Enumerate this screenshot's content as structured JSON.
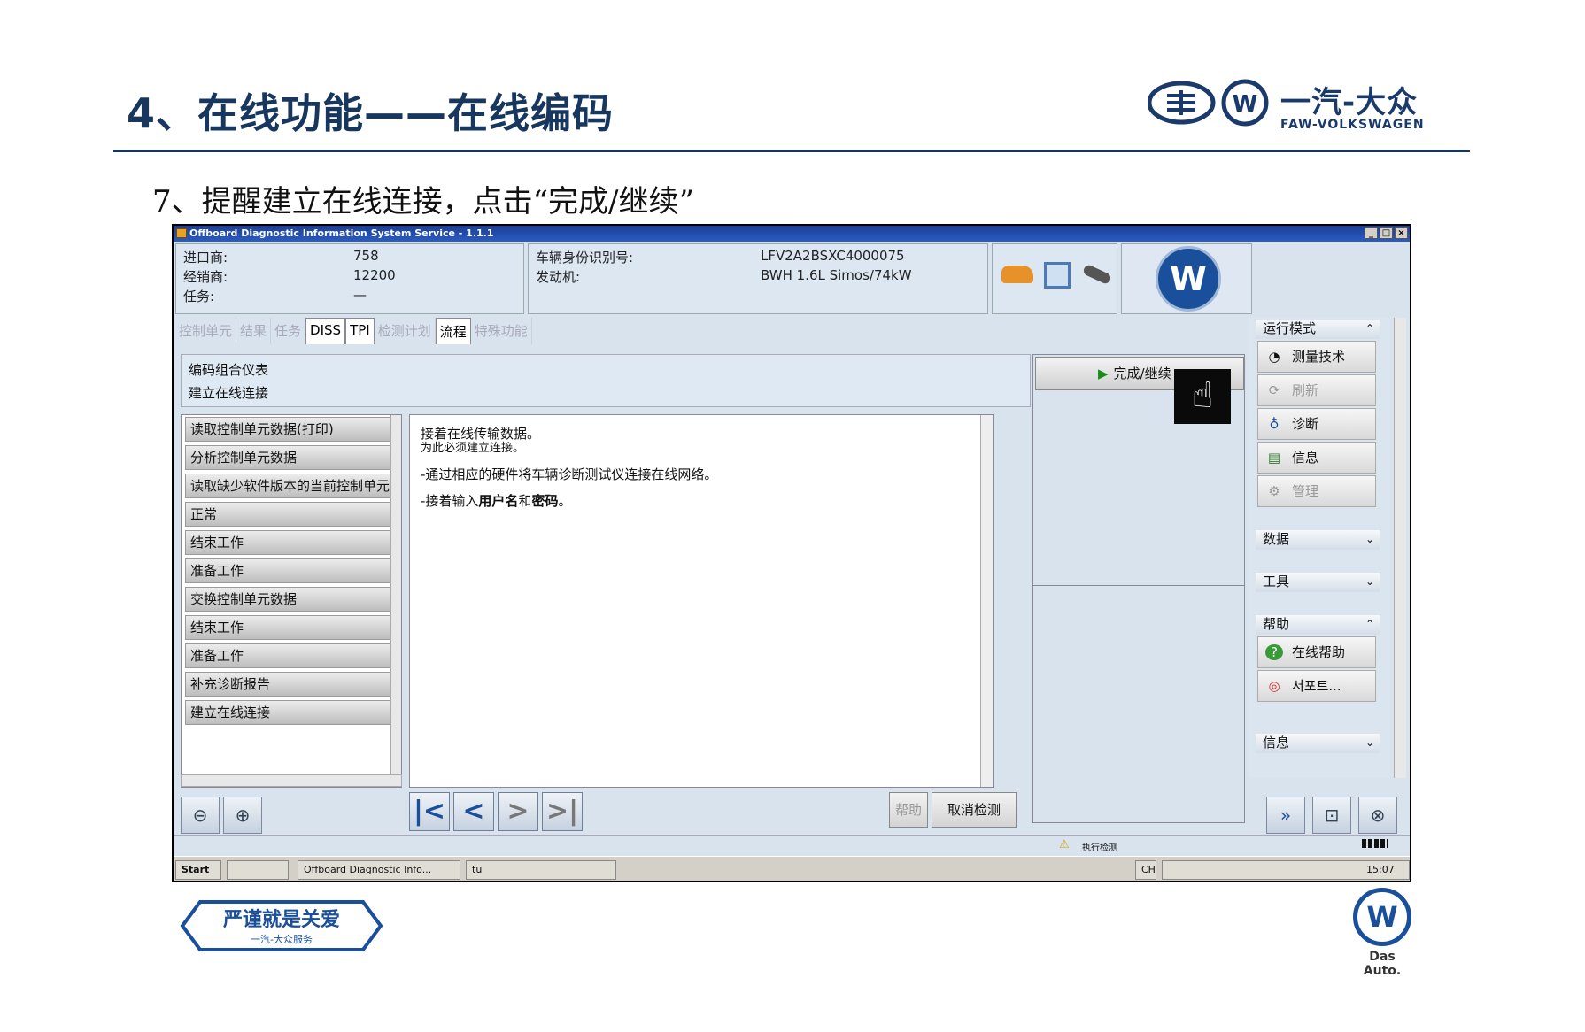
{
  "slide": {
    "title": "4、在线功能——在线编码",
    "subtitle": "7、提醒建立在线连接，点击“完成/继续”",
    "brand_cn": "一汽-大众",
    "brand_en": "FAW-VOLKSWAGEN",
    "footer_slogan": "严谨就是关爱",
    "footer_slogan_sub": "一汽-大众服务",
    "das_auto": "Das Auto."
  },
  "window": {
    "title": "Offboard Diagnostic Information System Service - 1.1.1"
  },
  "info": {
    "importer_label": "进口商:",
    "importer_value": "758",
    "dealer_label": "经销商:",
    "dealer_value": "12200",
    "task_label": "任务:",
    "task_value": "—",
    "vin_label": "车辆身份识别号:",
    "vin_value": "LFV2A2BSXC4000075",
    "engine_label": "发动机:",
    "engine_value": "BWH 1.6L Simos/74kW"
  },
  "tabs": [
    "控制单元",
    "结果",
    "任务",
    "DISS",
    "TPI",
    "检测计划",
    "流程",
    "特殊功能"
  ],
  "crumb": {
    "line1": "编码组合仪表",
    "line2": "建立在线连接"
  },
  "steps": [
    "读取控制单元数据(打印)",
    "分析控制单元数据",
    "读取缺少软件版本的当前控制单元数据",
    "正常",
    "结束工作",
    "准备工作",
    "交换控制单元数据",
    "结束工作",
    "准备工作",
    "补充诊断报告",
    "建立在线连接"
  ],
  "content": {
    "line1": "接着在线传输数据。",
    "line2": "为此必须建立连接。",
    "line3": "-通过相应的硬件将车辆诊断测试仪连接在线网络。",
    "line4_pre": "-接着输入",
    "line4_bold1": "用户名",
    "line4_mid": "和",
    "line4_bold2": "密码",
    "line4_post": "。"
  },
  "done_button": "完成/继续",
  "buttons": {
    "help": "帮助",
    "cancel": "取消检测"
  },
  "sidebar": {
    "mode_header": "运行模式",
    "measure": "测量技术",
    "refresh": "刷新",
    "diagnose": "诊断",
    "info": "信息",
    "manage": "管理",
    "data_header": "数据",
    "tools_header": "工具",
    "help_header": "帮助",
    "online_help": "在线帮助",
    "support": "서포트...",
    "info_header": "信息"
  },
  "status": {
    "text": "执行检测"
  },
  "taskbar": {
    "start": "Start",
    "task1": "Offboard Diagnostic Info...",
    "task2": "tu",
    "lang": "CH",
    "clock": "15:07"
  }
}
